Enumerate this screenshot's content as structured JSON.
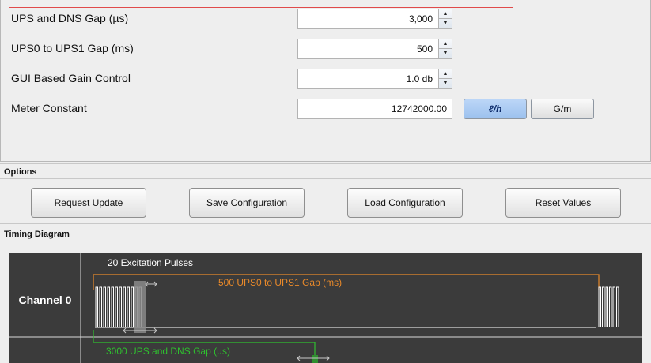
{
  "config": {
    "ups_dns_gap": {
      "label": "UPS and DNS Gap (µs)",
      "value": "3,000"
    },
    "ups0_ups1_gap": {
      "label": "UPS0 to UPS1 Gap (ms)",
      "value": "500"
    },
    "gain_control": {
      "label": "GUI Based Gain Control",
      "value": "1.0 db"
    },
    "meter_constant": {
      "label": "Meter Constant",
      "value": "12742000.00"
    },
    "units": {
      "selected": "ℓ/h",
      "other": "G/m"
    }
  },
  "options": {
    "header": "Options",
    "buttons": {
      "request_update": "Request Update",
      "save_configuration": "Save Configuration",
      "load_configuration": "Load Configuration",
      "reset_values": "Reset Values"
    }
  },
  "timing": {
    "header": "Timing Diagram",
    "channel0": "Channel 0",
    "excitation_label": "20 Excitation Pulses",
    "ups_gap_label": "500 UPS0 to UPS1 Gap (ms)",
    "dns_gap_label": "3000 UPS and DNS Gap (µs)"
  },
  "colors": {
    "highlight": "#e04a4a",
    "orange": "#e8892a",
    "green": "#2fbf2f",
    "diagram_bg": "#3b3b3b",
    "selected_unit": "#a8c8f2"
  },
  "icons": [
    "spinner-up-icon",
    "spinner-down-icon",
    "double-arrow-icon"
  ]
}
